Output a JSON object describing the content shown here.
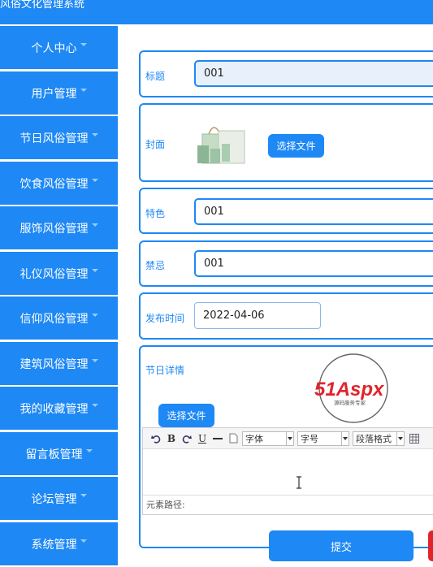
{
  "app": {
    "title": "风俗文化管理系统"
  },
  "sidebar": {
    "items": [
      {
        "label": "个人中心"
      },
      {
        "label": "用户管理"
      },
      {
        "label": "节日风俗管理"
      },
      {
        "label": "饮食风俗管理"
      },
      {
        "label": "服饰风俗管理"
      },
      {
        "label": "礼仪风俗管理"
      },
      {
        "label": "信仰风俗管理"
      },
      {
        "label": "建筑风俗管理"
      },
      {
        "label": "我的收藏管理"
      },
      {
        "label": "留言板管理"
      },
      {
        "label": "论坛管理"
      },
      {
        "label": "系统管理"
      }
    ]
  },
  "form": {
    "title": {
      "label": "标题",
      "value": "001"
    },
    "cover": {
      "label": "封面",
      "button": "选择文件"
    },
    "feature": {
      "label": "特色",
      "value": "001"
    },
    "taboo": {
      "label": "禁忌",
      "value": "001"
    },
    "publish_time": {
      "label": "发布时间",
      "value": "2022-04-06"
    },
    "festival_detail": {
      "label": "节日详情",
      "button": "选择文件"
    },
    "submit": "提交"
  },
  "editor": {
    "font_select": "字体",
    "size_select": "字号",
    "paragraph_select": "段落格式",
    "status": "元素路径:"
  },
  "watermark": {
    "brand": "51Aspx",
    "tagline": "源码服务专家"
  },
  "colors": {
    "primary": "#1e88f5",
    "watermark_red": "#e0242b"
  }
}
